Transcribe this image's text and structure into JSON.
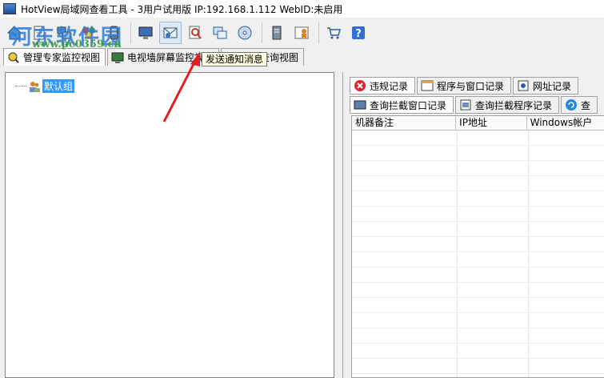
{
  "window": {
    "title": "HotView局域网查看工具 - 3用户试用版 IP:192.168.1.112 WebID:未启用"
  },
  "watermark": {
    "text": "河东软件园",
    "url": "www.pc0359.cn"
  },
  "toolbar": {
    "buttons": [
      {
        "icon": "home-icon"
      },
      {
        "icon": "document-icon"
      },
      {
        "icon": "network-icon"
      },
      {
        "icon": "colorful-balls-icon"
      },
      {
        "icon": "phone-icon"
      },
      {
        "icon": "monitor-icon"
      },
      {
        "icon": "send-message-icon"
      },
      {
        "icon": "magnifier-icon"
      },
      {
        "icon": "windows-icon"
      },
      {
        "icon": "cd-icon"
      },
      {
        "icon": "server-icon"
      },
      {
        "icon": "user-card-icon"
      },
      {
        "icon": "cart-icon"
      },
      {
        "icon": "help-icon"
      }
    ],
    "tooltip": "发送通知消息"
  },
  "tabs": [
    {
      "label": "管理专家监控视图",
      "icon": "monitor-expert-icon"
    },
    {
      "label": "电视墙屏幕监控视图",
      "icon": "tv-wall-icon"
    },
    {
      "label": "数据查询视图",
      "icon": "data-query-icon"
    }
  ],
  "tree": {
    "root_label": "默认组"
  },
  "right_tabs_row1": [
    {
      "label": "违规记录",
      "icon": "violation-icon",
      "color": "#d9262c"
    },
    {
      "label": "程序与窗口记录",
      "icon": "program-window-icon"
    },
    {
      "label": "网址记录",
      "icon": "url-icon"
    }
  ],
  "right_tabs_row2": [
    {
      "label": "查询拦截窗口记录",
      "icon": "intercept-window-icon"
    },
    {
      "label": "查询拦截程序记录",
      "icon": "intercept-program-icon"
    },
    {
      "label": "查",
      "icon": "query-icon"
    }
  ],
  "grid": {
    "columns": [
      "机器备注",
      "IP地址",
      "Windows帐户"
    ]
  },
  "colors": {
    "selection": "#3399ff",
    "watermark_blue": "#2e7bd6",
    "watermark_green": "#3a9a3a",
    "arrow": "#e02020"
  }
}
